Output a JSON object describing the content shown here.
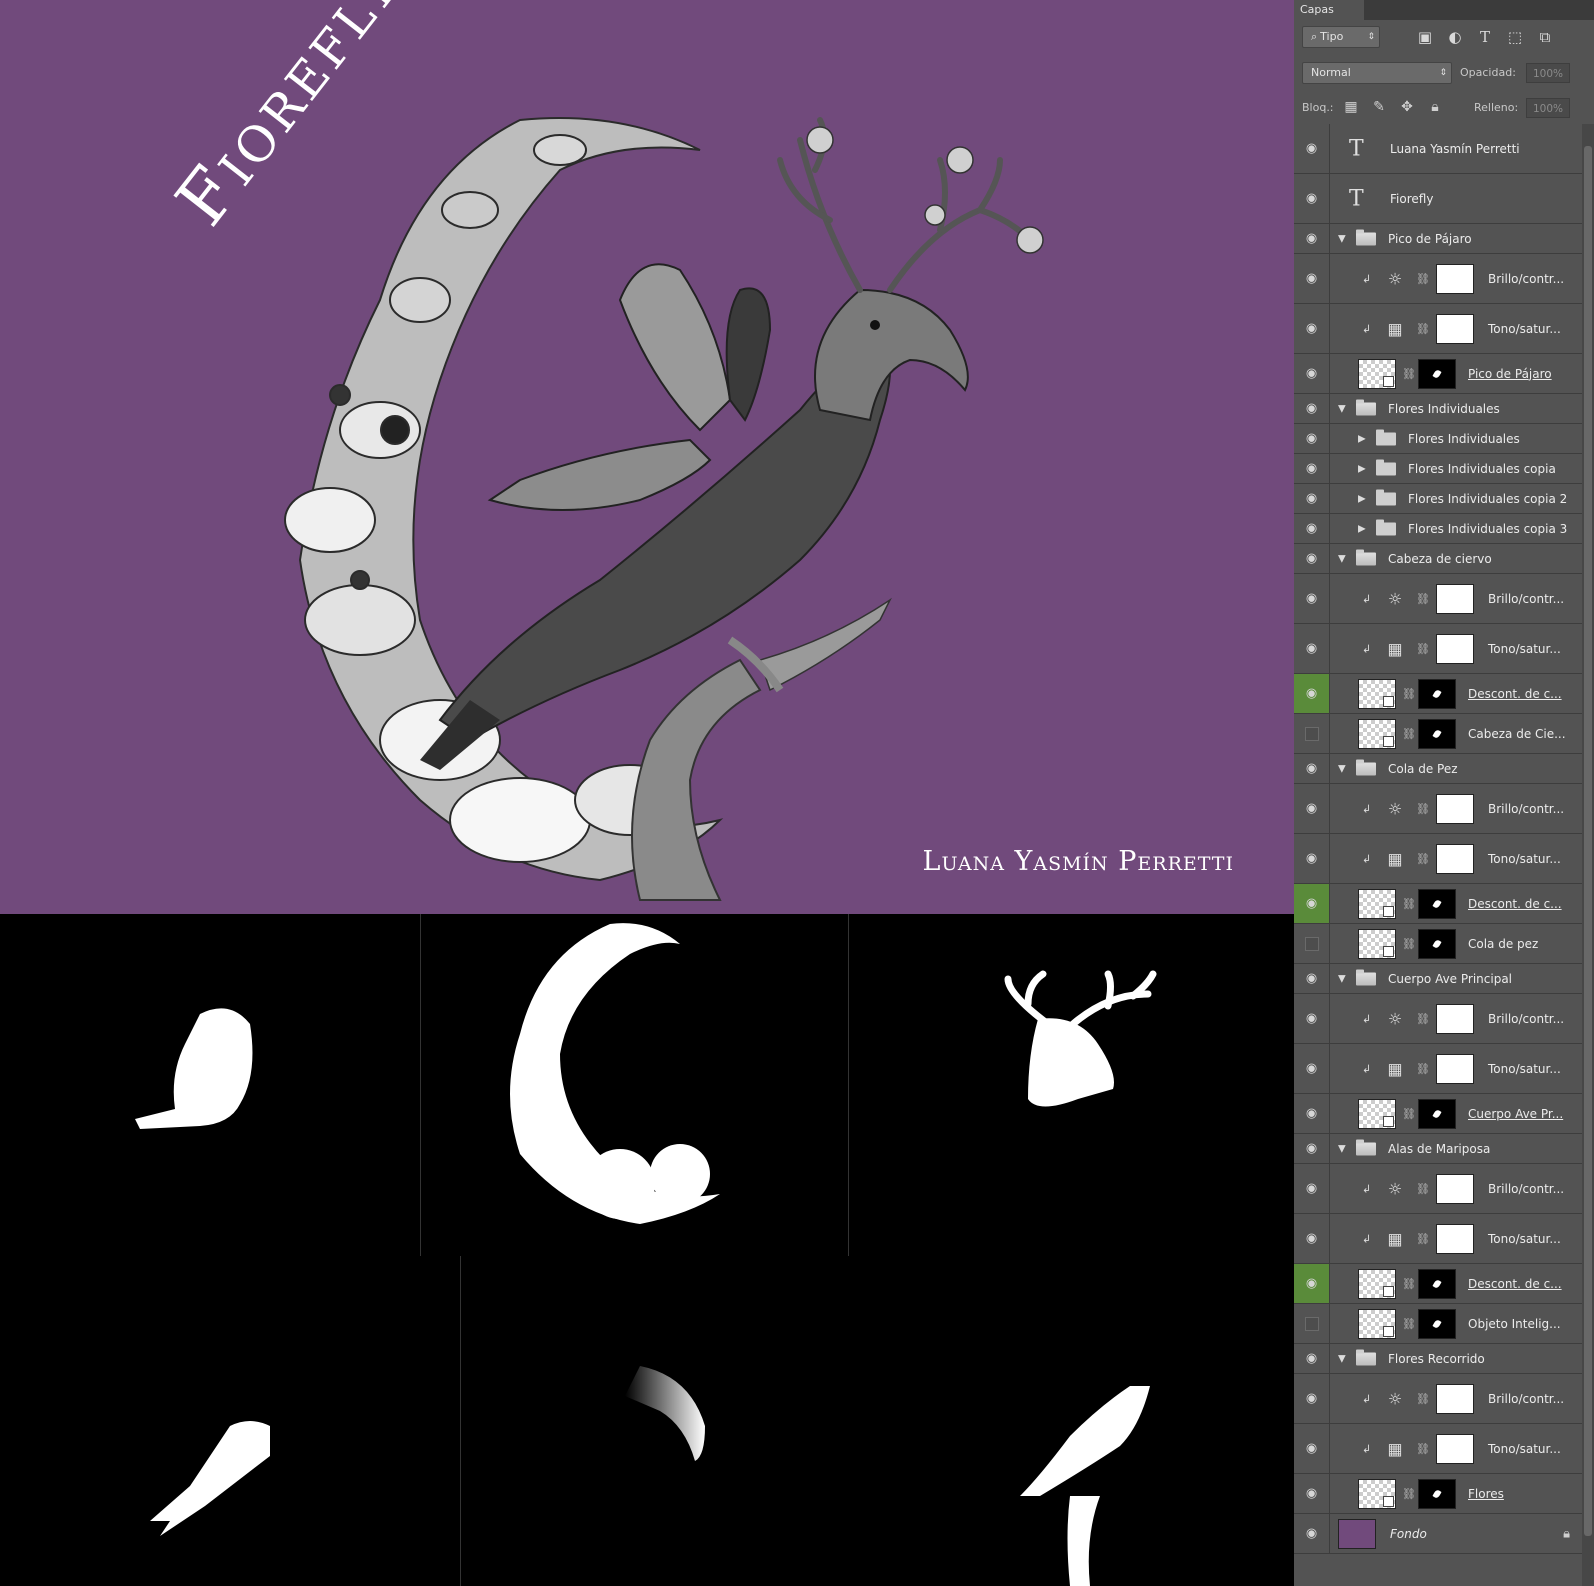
{
  "cover": {
    "title": "Fiorefly",
    "author": "Luana Yasmín Perretti",
    "background": "#714a7c"
  },
  "masks": [
    {
      "name": "butterfly-wings-mask"
    },
    {
      "name": "flower-crescent-mask"
    },
    {
      "name": "deer-head-mask"
    },
    {
      "name": "fish-tail-mask"
    },
    {
      "name": "bird-beak-mask"
    },
    {
      "name": "bird-body-mask"
    }
  ],
  "panel": {
    "tab_label": "Capas",
    "filter_kind": "Tipo",
    "blend_mode": "Normal",
    "opacity_label": "Opacidad:",
    "opacity_value": "100%",
    "lock_label": "Bloq.:",
    "fill_label": "Relleno:",
    "fill_value": "100%",
    "filter_icons": [
      "image-filter-icon",
      "adjustment-filter-icon",
      "type-filter-icon",
      "shape-filter-icon",
      "smart-object-filter-icon"
    ],
    "lock_icons": [
      "lock-transparent-icon",
      "lock-paint-icon",
      "lock-move-icon",
      "lock-all-icon"
    ]
  },
  "layers": [
    {
      "kind": "text",
      "name": "Luana Yasmín Perretti",
      "eye": "on"
    },
    {
      "kind": "text",
      "name": "Fiorefly",
      "eye": "on"
    },
    {
      "kind": "group",
      "name": "Pico de Pájaro",
      "eye": "on",
      "open": true
    },
    {
      "kind": "adj-brightness",
      "name": "Brillo/contr...",
      "eye": "on"
    },
    {
      "kind": "adj-hue",
      "name": "Tono/satur...",
      "eye": "on"
    },
    {
      "kind": "masked",
      "name": "Pico de Pájaro",
      "eye": "on",
      "underline": true
    },
    {
      "kind": "group",
      "name": "Flores Individuales",
      "eye": "on",
      "open": true
    },
    {
      "kind": "subgroup",
      "name": "Flores Individuales",
      "eye": "on"
    },
    {
      "kind": "subgroup",
      "name": "Flores Individuales copia",
      "eye": "on"
    },
    {
      "kind": "subgroup",
      "name": "Flores Individuales copia 2",
      "eye": "on"
    },
    {
      "kind": "subgroup",
      "name": "Flores Individuales copia 3",
      "eye": "on"
    },
    {
      "kind": "group",
      "name": "Cabeza de ciervo",
      "eye": "on",
      "open": true
    },
    {
      "kind": "adj-brightness",
      "name": "Brillo/contr...",
      "eye": "on"
    },
    {
      "kind": "adj-hue",
      "name": "Tono/satur...",
      "eye": "on"
    },
    {
      "kind": "masked",
      "name": "Descont. de c...",
      "eye": "green",
      "underline": true
    },
    {
      "kind": "masked",
      "name": "Cabeza de Cie...",
      "eye": "off"
    },
    {
      "kind": "group",
      "name": "Cola de Pez",
      "eye": "on",
      "open": true
    },
    {
      "kind": "adj-brightness",
      "name": "Brillo/contr...",
      "eye": "on"
    },
    {
      "kind": "adj-hue",
      "name": "Tono/satur...",
      "eye": "on"
    },
    {
      "kind": "masked",
      "name": "Descont. de c...",
      "eye": "green",
      "underline": true
    },
    {
      "kind": "masked",
      "name": "Cola de pez",
      "eye": "off"
    },
    {
      "kind": "group",
      "name": "Cuerpo Ave Principal",
      "eye": "on",
      "open": true
    },
    {
      "kind": "adj-brightness",
      "name": "Brillo/contr...",
      "eye": "on"
    },
    {
      "kind": "adj-hue",
      "name": "Tono/satur...",
      "eye": "on"
    },
    {
      "kind": "masked",
      "name": "Cuerpo Ave Pr...",
      "eye": "on",
      "underline": true
    },
    {
      "kind": "group",
      "name": "Alas de Mariposa",
      "eye": "on",
      "open": true
    },
    {
      "kind": "adj-brightness",
      "name": "Brillo/contr...",
      "eye": "on"
    },
    {
      "kind": "adj-hue",
      "name": "Tono/satur...",
      "eye": "on"
    },
    {
      "kind": "masked",
      "name": "Descont. de c...",
      "eye": "green",
      "underline": true
    },
    {
      "kind": "masked",
      "name": "Objeto Intelig...",
      "eye": "off"
    },
    {
      "kind": "group",
      "name": "Flores Recorrido",
      "eye": "on",
      "open": true
    },
    {
      "kind": "adj-brightness",
      "name": "Brillo/contr...",
      "eye": "on"
    },
    {
      "kind": "adj-hue",
      "name": "Tono/satur...",
      "eye": "on"
    },
    {
      "kind": "masked",
      "name": "Flores",
      "eye": "on",
      "underline": true
    },
    {
      "kind": "background",
      "name": "Fondo",
      "eye": "on",
      "color": "#714a7c",
      "locked": true
    }
  ]
}
